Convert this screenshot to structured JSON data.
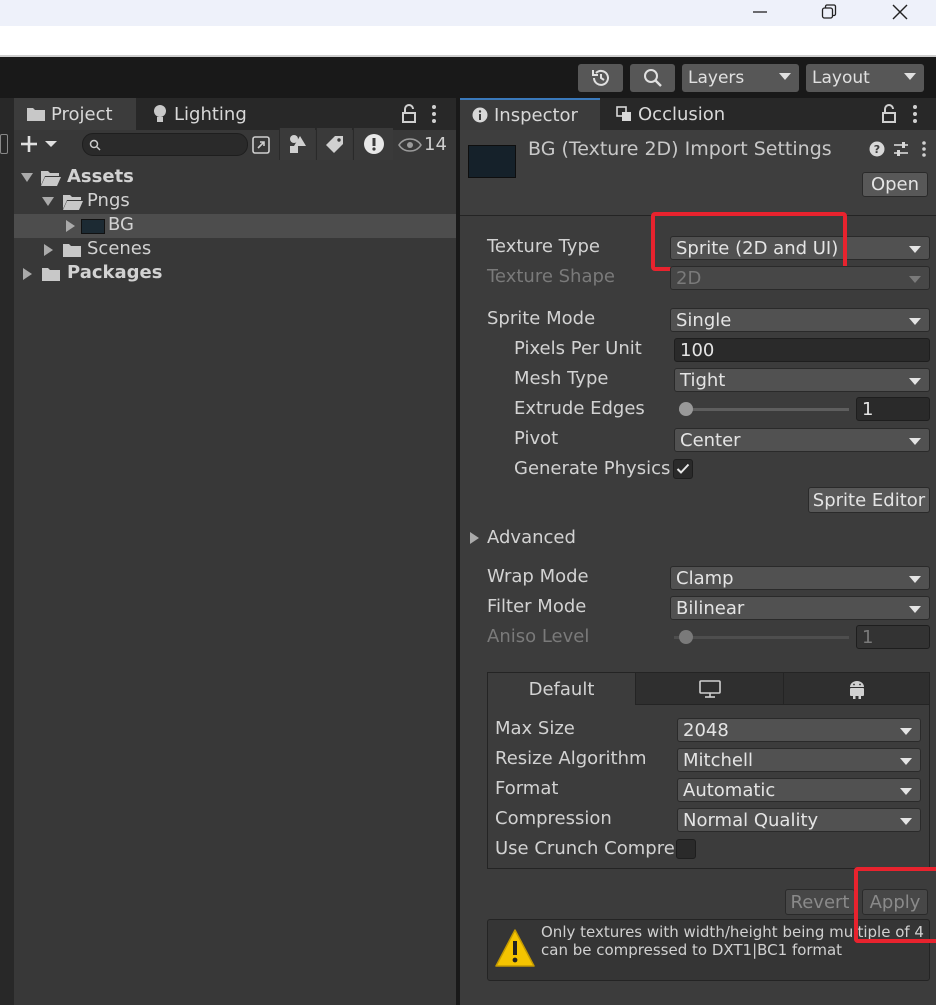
{
  "window": {
    "minimize_icon": "minimize-icon",
    "maximize_icon": "restore-icon",
    "close_icon": "close-icon"
  },
  "toolbar": {
    "layers_label": "Layers",
    "layout_label": "Layout"
  },
  "project": {
    "tabs": [
      {
        "label": "Project",
        "icon": "folder-icon"
      },
      {
        "label": "Lighting",
        "icon": "lightbulb-icon"
      }
    ],
    "search_placeholder": "",
    "hidden_count": "14",
    "tree": {
      "assets": "Assets",
      "pngs": "Pngs",
      "bg": "BG",
      "scenes": "Scenes",
      "packages": "Packages"
    }
  },
  "inspector": {
    "tabs": [
      {
        "label": "Inspector",
        "icon": "info-icon"
      },
      {
        "label": "Occlusion",
        "icon": "occlusion-icon"
      }
    ],
    "header_title": "BG (Texture 2D) Import Settings",
    "open_label": "Open",
    "texture_type": {
      "label": "Texture Type",
      "value": "Sprite (2D and UI)"
    },
    "texture_shape": {
      "label": "Texture Shape",
      "value": "2D"
    },
    "sprite_mode": {
      "label": "Sprite Mode",
      "value": "Single"
    },
    "pixels_per_unit": {
      "label": "Pixels Per Unit",
      "value": "100"
    },
    "mesh_type": {
      "label": "Mesh Type",
      "value": "Tight"
    },
    "extrude_edges": {
      "label": "Extrude Edges",
      "value": "1",
      "slider_fraction": 0.0
    },
    "pivot": {
      "label": "Pivot",
      "value": "Center"
    },
    "generate_physics": {
      "label": "Generate Physics",
      "checked": true
    },
    "sprite_editor_label": "Sprite Editor",
    "advanced_label": "Advanced",
    "wrap_mode": {
      "label": "Wrap Mode",
      "value": "Clamp"
    },
    "filter_mode": {
      "label": "Filter Mode",
      "value": "Bilinear"
    },
    "aniso_level": {
      "label": "Aniso Level",
      "value": "1",
      "slider_fraction": 0.0
    },
    "platform_tabs": {
      "default_label": "Default",
      "standalone_icon": "monitor-icon",
      "android_icon": "android-icon"
    },
    "max_size": {
      "label": "Max Size",
      "value": "2048"
    },
    "resize_algorithm": {
      "label": "Resize Algorithm",
      "value": "Mitchell"
    },
    "format": {
      "label": "Format",
      "value": "Automatic"
    },
    "compression": {
      "label": "Compression",
      "value": "Normal Quality"
    },
    "use_crunch": {
      "label": "Use Crunch Compre",
      "checked": false
    },
    "revert_label": "Revert",
    "apply_label": "Apply",
    "warning_line1": "Only textures with width/height being multiple of 4",
    "warning_line2": "can be compressed to DXT1|BC1 format"
  },
  "colors": {
    "highlight_box": "#e8232e",
    "panel_bg": "#383838",
    "toolbar_bg": "#191919",
    "warning_yellow": "#f5c400"
  }
}
